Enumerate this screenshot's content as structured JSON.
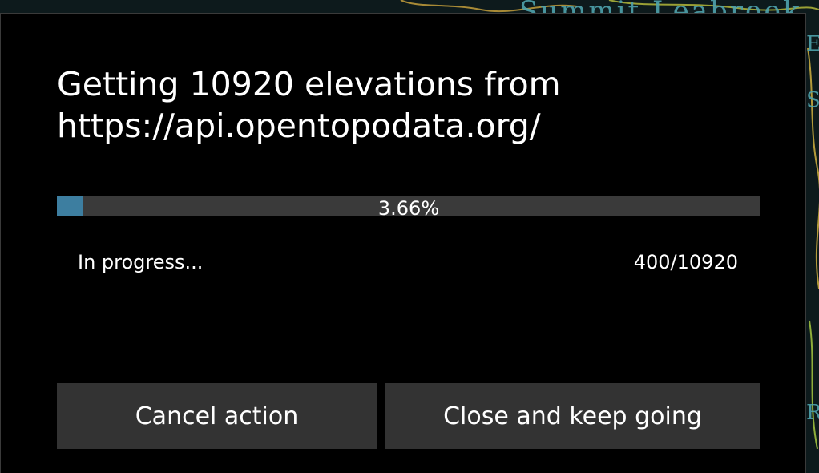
{
  "background_map": {
    "labels": [
      "Summit Leabrook",
      "E",
      "S",
      "Ri"
    ]
  },
  "dialog": {
    "title": "Getting 10920 elevations from https://api.opentopodata.org/",
    "progress": {
      "percent_text": "3.66%",
      "fraction": 0.0366,
      "fill_color": "#3d7ea0"
    },
    "status": "In progress...",
    "count": "400/10920",
    "buttons": {
      "cancel": "Cancel action",
      "close": "Close and keep going"
    }
  }
}
